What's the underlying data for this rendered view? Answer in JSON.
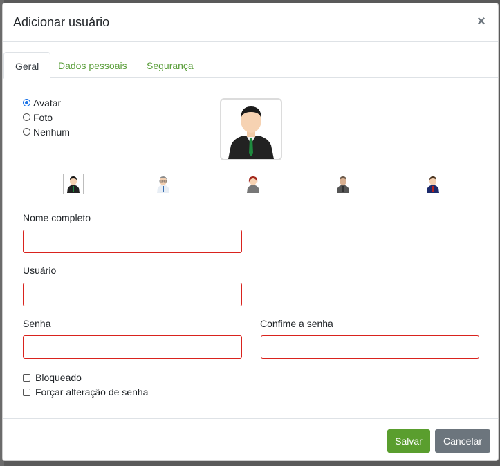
{
  "modal": {
    "title": "Adicionar usuário",
    "close": "×"
  },
  "tabs": [
    {
      "label": "Geral",
      "active": true
    },
    {
      "label": "Dados pessoais",
      "active": false
    },
    {
      "label": "Segurança",
      "active": false
    }
  ],
  "image_type": {
    "options": [
      {
        "label": "Avatar",
        "checked": true
      },
      {
        "label": "Foto",
        "checked": false
      },
      {
        "label": "Nenhum",
        "checked": false
      }
    ]
  },
  "avatars": {
    "large_icon": "businessman-avatar-icon",
    "options": [
      {
        "icon": "businessman-green-tie-icon",
        "selected": true
      },
      {
        "icon": "man-glasses-icon",
        "selected": false
      },
      {
        "icon": "woman-red-hair-icon",
        "selected": false
      },
      {
        "icon": "man-gray-suit-icon",
        "selected": false
      },
      {
        "icon": "man-blue-suit-icon",
        "selected": false
      }
    ]
  },
  "form": {
    "full_name_label": "Nome completo",
    "full_name_value": "",
    "username_label": "Usuário",
    "username_value": "",
    "password_label": "Senha",
    "password_value": "",
    "confirm_password_label": "Confime a senha",
    "confirm_password_value": "",
    "blocked_label": "Bloqueado",
    "blocked_checked": false,
    "force_change_label": "Forçar alteração de senha",
    "force_change_checked": false
  },
  "footer": {
    "save_label": "Salvar",
    "cancel_label": "Cancelar"
  },
  "colors": {
    "accent_green": "#5a9e2e",
    "error_border": "#d9231e",
    "cancel_gray": "#6c757d"
  }
}
